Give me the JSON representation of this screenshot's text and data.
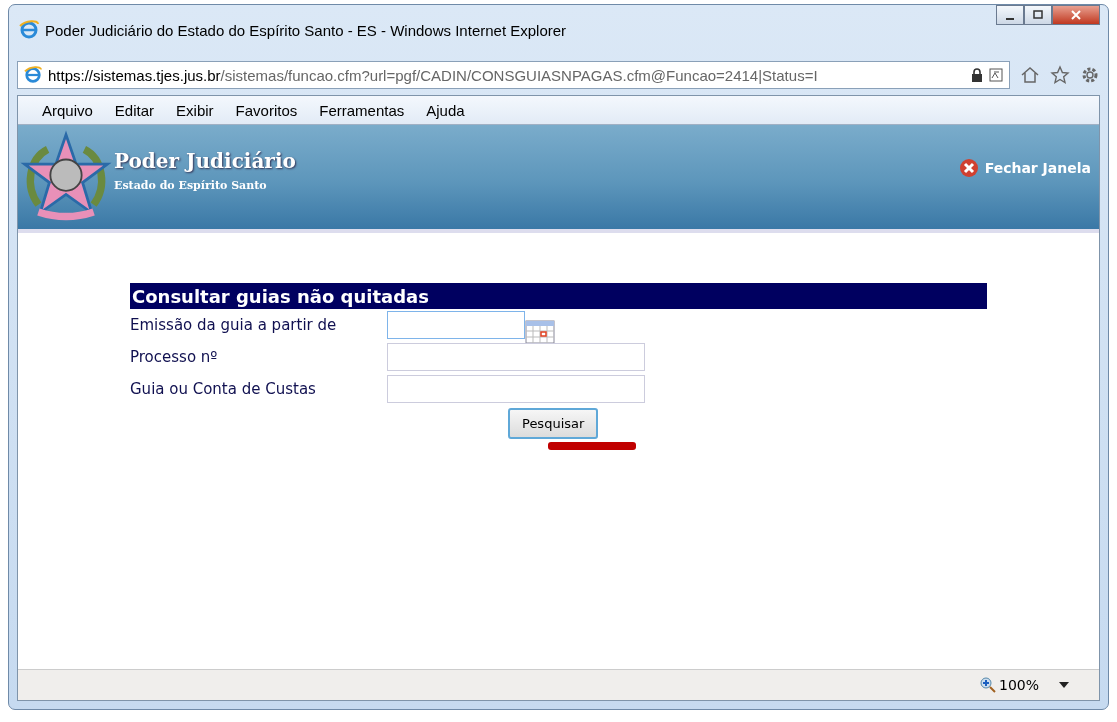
{
  "window": {
    "title": "Poder Judiciário do Estado do Espírito Santo - ES - Windows Internet Explorer"
  },
  "address_bar": {
    "host": "https://sistemas.tjes.jus.br",
    "path": "/sistemas/funcao.cfm?url=pgf/CADIN/CONSGUIASNPAGAS.cfm@Funcao=2414|Status=I"
  },
  "menu": [
    "Arquivo",
    "Editar",
    "Exibir",
    "Favoritos",
    "Ferramentas",
    "Ajuda"
  ],
  "header": {
    "title": "Poder Judiciário",
    "subtitle": "Estado do Espírito Santo",
    "close_link": "Fechar Janela"
  },
  "form": {
    "title": "Consultar guias não quitadas",
    "fields": [
      {
        "label": "Emissão da guia a partir de",
        "kind": "date",
        "focused": true
      },
      {
        "label": "Processo nº",
        "kind": "text",
        "focused": false
      },
      {
        "label": "Guia ou Conta de Custas",
        "kind": "text",
        "focused": false
      }
    ],
    "button": "Pesquisar"
  },
  "status_bar": {
    "zoom": "100%"
  }
}
